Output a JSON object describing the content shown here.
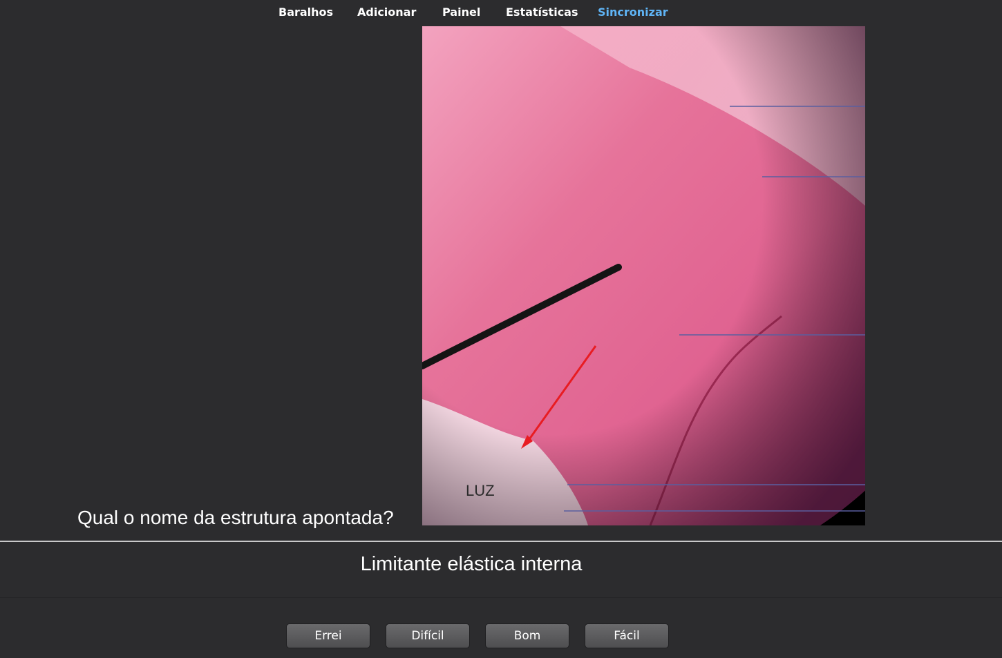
{
  "nav": {
    "items": [
      {
        "label": "Baralhos",
        "active": false
      },
      {
        "label": "Adicionar",
        "active": false
      },
      {
        "label": "Painel",
        "active": false
      },
      {
        "label": "Estatísticas",
        "active": false
      },
      {
        "label": "Sincronizar",
        "active": true
      }
    ],
    "active_color": "#5fb4f5"
  },
  "card": {
    "question": "Qual o nome da estrutura apontada?",
    "image_label": "LUZ",
    "answer": "Limitante elástica interna"
  },
  "answer_buttons": [
    {
      "label": "Errei"
    },
    {
      "label": "Difícil"
    },
    {
      "label": "Bom"
    },
    {
      "label": "Fácil"
    }
  ]
}
